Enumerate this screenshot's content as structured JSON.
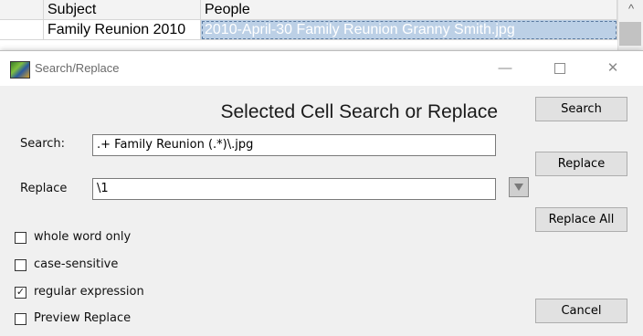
{
  "sheet": {
    "columns": [
      "Subject",
      "People"
    ],
    "rows": [
      {
        "subject": "Family Reunion 2010",
        "people": "2010-April-30 Family Reunion Granny Smith.jpg"
      }
    ]
  },
  "dialog": {
    "title": "Search/Replace",
    "heading": "Selected Cell Search or Replace",
    "search_label": "Search:",
    "search_value": ".+ Family Reunion (.*)\\.jpg",
    "replace_label": "Replace",
    "replace_value": "\\1",
    "buttons": {
      "search": "Search",
      "replace": "Replace",
      "replace_all": "Replace All",
      "cancel": "Cancel"
    },
    "options": [
      {
        "label": "whole word only",
        "checked": false
      },
      {
        "label": "case-sensitive",
        "checked": false
      },
      {
        "label": "regular expression",
        "checked": true
      },
      {
        "label": "Preview Replace",
        "checked": false
      }
    ],
    "window_controls": {
      "minimize": "—",
      "close": "✕"
    }
  },
  "icons": {
    "app": "app-icon",
    "dropdown": "dropdown-arrow-icon",
    "scroll_up": "scroll-up-arrow-icon"
  }
}
